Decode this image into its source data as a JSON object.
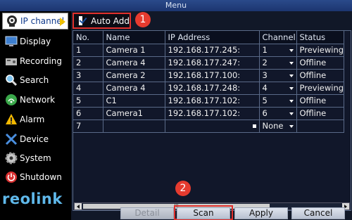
{
  "window": {
    "title": "Menu"
  },
  "sidebar": {
    "items": [
      {
        "label": "IP channel",
        "icon": "camera-icon",
        "active": true
      },
      {
        "label": "Display",
        "icon": "monitor-icon"
      },
      {
        "label": "Recording",
        "icon": "recorder-icon"
      },
      {
        "label": "Search",
        "icon": "magnifier-icon"
      },
      {
        "label": "Network",
        "icon": "network-icon"
      },
      {
        "label": "Alarm",
        "icon": "warning-icon"
      },
      {
        "label": "Device",
        "icon": "tools-icon"
      },
      {
        "label": "System",
        "icon": "gear-icon"
      },
      {
        "label": "Shutdown",
        "icon": "power-icon"
      }
    ],
    "logo_text": "reolink"
  },
  "auto_add": {
    "label": "Auto Add",
    "checked": true
  },
  "badges": {
    "first": "1",
    "second": "2"
  },
  "table": {
    "columns": [
      "No.",
      "Name",
      "IP Address",
      "Channel",
      "Status"
    ],
    "rows": [
      {
        "no": "1",
        "name": "Camera 1",
        "ip": "192.168.177.245:",
        "channel": "1",
        "status": "Previewing"
      },
      {
        "no": "2",
        "name": "Camera 4",
        "ip": "192.168.177.247:",
        "channel": "2",
        "status": "Offline"
      },
      {
        "no": "3",
        "name": "Camera 2",
        "ip": "192.168.177.100:",
        "channel": "3",
        "status": "Offline"
      },
      {
        "no": "4",
        "name": "Camera 4",
        "ip": "192.168.177.248:",
        "channel": "4",
        "status": "Previewing"
      },
      {
        "no": "5",
        "name": "C1",
        "ip": "192.168.177.102:",
        "channel": "5",
        "status": "Offline"
      },
      {
        "no": "6",
        "name": "Camera1",
        "ip": "192.168.177.102:",
        "channel": "6",
        "status": "Offline"
      },
      {
        "no": "7",
        "name": "",
        "ip": "",
        "channel": "None",
        "status": ""
      }
    ],
    "scrollbar_thumb_label": "III"
  },
  "buttons": {
    "detail": "Detail",
    "scan": "Scan",
    "apply": "Apply",
    "cancel": "Cancel"
  },
  "colors": {
    "highlight": "#e0302c",
    "accent": "#f0c000",
    "logo": "#5fb8ea"
  }
}
